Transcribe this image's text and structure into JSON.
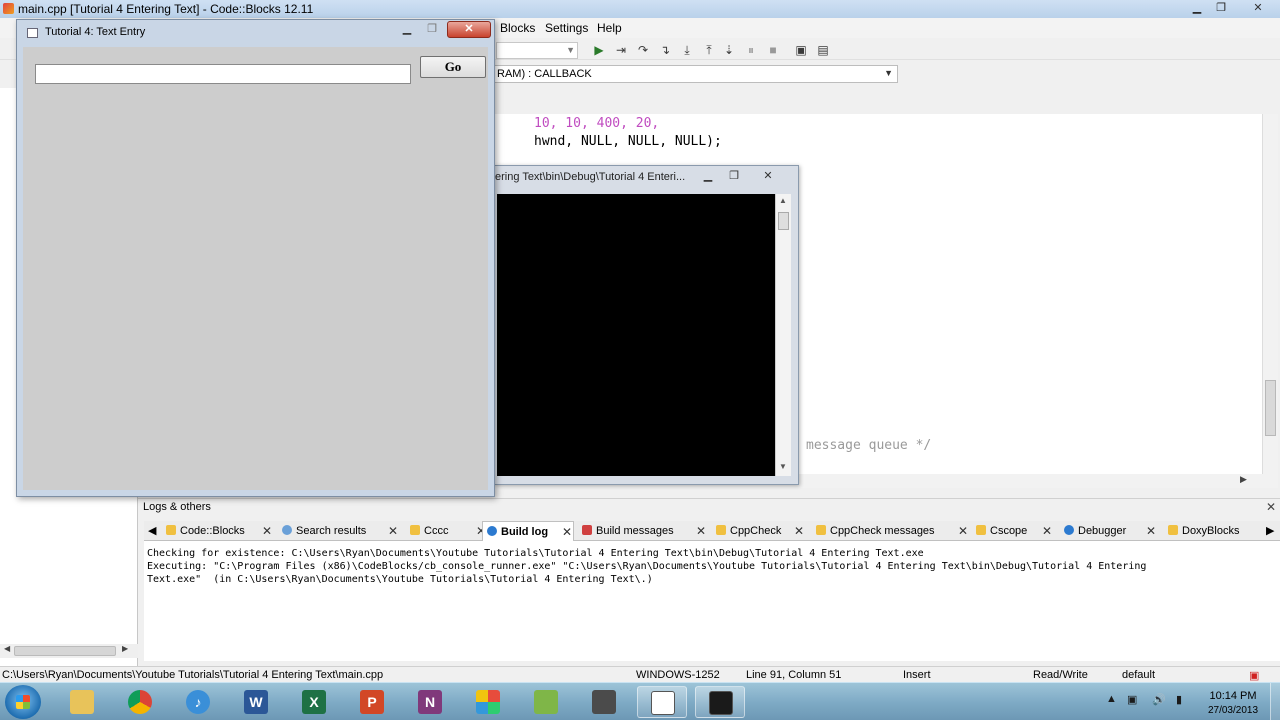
{
  "ide": {
    "title": "main.cpp [Tutorial 4 Entering Text] - Code::Blocks 12.11",
    "menu": [
      "Blocks",
      "Settings",
      "Help"
    ],
    "scope_function": "RAM) : CALLBACK",
    "code_lines": [
      "10, 10, 400, 20,",
      "hwnd, NULL, NULL, NULL);",
      "message queue */"
    ]
  },
  "console": {
    "title": "ering Text\\bin\\Debug\\Tutorial 4 Enteri..."
  },
  "tutorial_window": {
    "title": "Tutorial 4: Text Entry",
    "input_value": "",
    "go_label": "Go"
  },
  "logs": {
    "header": "Logs & others",
    "tabs": [
      "Code::Blocks",
      "Search results",
      "Cccc",
      "Build log",
      "Build messages",
      "CppCheck",
      "CppCheck messages",
      "Cscope",
      "Debugger",
      "DoxyBlocks"
    ],
    "active_tab": "Build log",
    "lines": [
      "Checking for existence: C:\\Users\\Ryan\\Documents\\Youtube Tutorials\\Tutorial 4 Entering Text\\bin\\Debug\\Tutorial 4 Entering Text.exe",
      "Executing: \"C:\\Program Files (x86)\\CodeBlocks/cb_console_runner.exe\" \"C:\\Users\\Ryan\\Documents\\Youtube Tutorials\\Tutorial 4 Entering Text\\bin\\Debug\\Tutorial 4 Entering",
      "Text.exe\"  (in C:\\Users\\Ryan\\Documents\\Youtube Tutorials\\Tutorial 4 Entering Text\\.)"
    ]
  },
  "status": {
    "path": "C:\\Users\\Ryan\\Documents\\Youtube Tutorials\\Tutorial 4 Entering Text\\main.cpp",
    "encoding": "WINDOWS-1252",
    "position": "Line 91, Column 51",
    "mode": "Insert",
    "access": "Read/Write",
    "profile": "default"
  },
  "taskbar": {
    "time": "10:14 PM",
    "date": "27/03/2013",
    "apps": [
      "explorer-icon",
      "chrome-icon",
      "itunes-icon",
      "word-icon",
      "excel-icon",
      "powerpoint-icon",
      "onenote-icon",
      "office-icon",
      "codeblocks-icon",
      "camtasia-icon",
      "window-icon",
      "console-icon"
    ]
  },
  "colors": {
    "code_number": "#c04cc0",
    "code_default": "#000000",
    "code_comment": "#9a9a9a",
    "code_paren": "#c21b1b"
  }
}
